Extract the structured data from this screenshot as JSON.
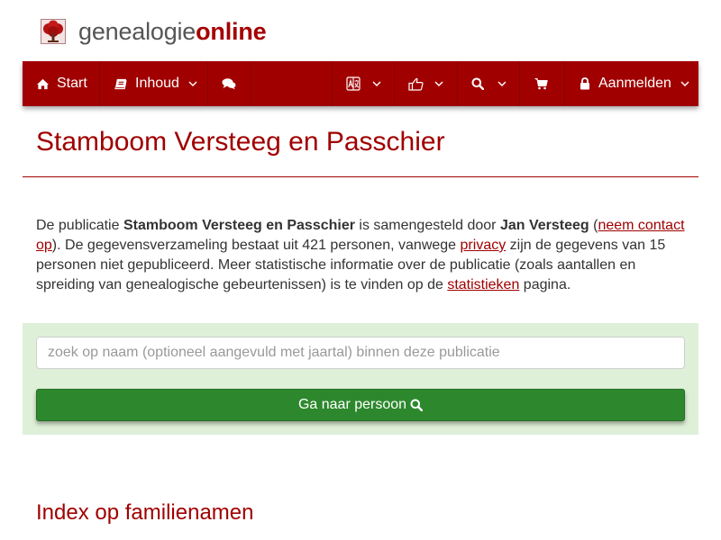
{
  "brand": {
    "part1": "genealogie",
    "part2": "online"
  },
  "nav": {
    "start_label": "Start",
    "inhoud_label": "Inhoud",
    "login_label": "Aanmelden"
  },
  "page": {
    "title": "Stamboom Versteeg en Passchier"
  },
  "intro": {
    "t1": "De publicatie ",
    "pub_name": "Stamboom Versteeg en Passchier",
    "t2": " is samengesteld door ",
    "author": "Jan Versteeg",
    "t3": "(",
    "contact_link": "neem contact op",
    "t4": "). De gegevensverzameling bestaat uit 421 personen, vanwege ",
    "privacy_link": "privacy",
    "t5": " zijn de gegevens van 15 personen niet gepubliceerd. Meer statistische informatie over de publicatie (zoals aantallen en spreiding van genealogische gebeurtenissen) is te vinden op de ",
    "stats_link": "statistieken",
    "t6": " pagina."
  },
  "search": {
    "placeholder": "zoek op naam (optioneel aangevuld met jaartal) binnen deze publicatie",
    "value": "",
    "button_label": "Ga naar persoon"
  },
  "index": {
    "title": "Index op familienamen"
  },
  "colors": {
    "brand_red": "#a00000",
    "panel_green": "#dff0d8",
    "button_green": "#2d882d"
  }
}
